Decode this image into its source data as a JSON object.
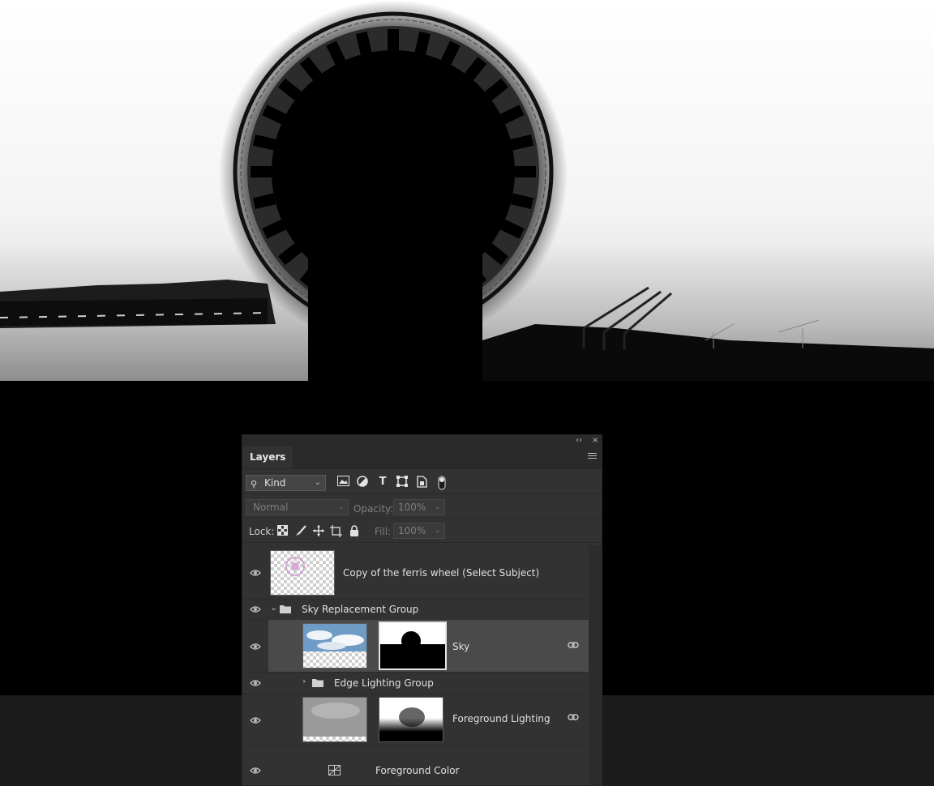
{
  "panel": {
    "title": "Layers",
    "collapse_glyph": "‹‹",
    "close_glyph": "×"
  },
  "filter": {
    "kind_label": "Kind",
    "icons": [
      "image-filter-icon",
      "adjustment-filter-icon",
      "type-filter-icon",
      "shape-filter-icon",
      "smart-object-filter-icon",
      "filter-toggle-icon"
    ]
  },
  "blend": {
    "mode": "Normal",
    "opacity_label": "Opacity:",
    "opacity_value": "100%",
    "fill_label": "Fill:",
    "fill_value": "100%"
  },
  "lock": {
    "label": "Lock:",
    "icons": [
      "lock-transparent-pixels-icon",
      "lock-image-pixels-icon",
      "lock-position-icon",
      "lock-artboard-icon",
      "lock-all-icon"
    ]
  },
  "layers": [
    {
      "name": "Copy of the ferris wheel (Select Subject)",
      "type": "pixel",
      "visible": true
    },
    {
      "name": "Sky Replacement Group",
      "type": "group",
      "expanded": true,
      "visible": true
    },
    {
      "name": "Sky",
      "type": "pixel-with-mask",
      "selected": true,
      "linked": true,
      "visible": true
    },
    {
      "name": "Edge Lighting Group",
      "type": "group",
      "expanded": false,
      "visible": true
    },
    {
      "name": "Foreground Lighting",
      "type": "pixel-with-mask",
      "linked": true,
      "visible": true
    },
    {
      "name": "Foreground Color",
      "type": "adjustment",
      "visible": true
    }
  ],
  "colors": {
    "panel_bg": "#323232",
    "selected_row": "#4a4a4a",
    "workspace_bg": "#1b1b1b",
    "canvas_bg": "#000000"
  }
}
